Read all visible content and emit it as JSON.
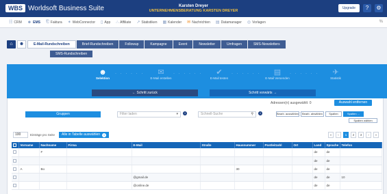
{
  "topbar": {
    "logo": "WBS",
    "app_name": "Worldsoft Business Suite",
    "user_name": "Karsten Dreyer",
    "company": "UNTERNEHMENSBERATUNG KARSTEN DREYER",
    "upgrade_label": "Upgrade",
    "help_glyph": "?",
    "settings_glyph": "⚙"
  },
  "nav": {
    "items": [
      {
        "icon": "grid-icon",
        "glyph": "☷",
        "label": "CRM"
      },
      {
        "icon": "people-icon",
        "glyph": "☻",
        "label": "EMS"
      },
      {
        "icon": "invoice-icon",
        "glyph": "⎗",
        "label": "Faktura"
      },
      {
        "icon": "connector-icon",
        "glyph": "✶",
        "label": "WebConnector"
      },
      {
        "icon": "app-icon",
        "glyph": "▯",
        "label": "App"
      },
      {
        "icon": "affiliate-icon",
        "glyph": "∴",
        "label": "Affiliate"
      },
      {
        "icon": "statistics-icon",
        "glyph": "↗",
        "label": "Statistiken"
      },
      {
        "icon": "calendar-icon",
        "glyph": "▦",
        "label": "Kalender"
      },
      {
        "icon": "messages-icon",
        "glyph": "✉",
        "label": "Nachrichten"
      },
      {
        "icon": "data-manager-icon",
        "glyph": "▤",
        "label": "Datamanager"
      },
      {
        "icon": "templates-icon",
        "glyph": "◎",
        "label": "Vorlagen"
      }
    ],
    "end_glyph": "%"
  },
  "module": {
    "home_glyph": "⌂",
    "people_glyph": "☻",
    "tabs": [
      {
        "label": "E-Mail-Rundschreiben",
        "active": true
      },
      {
        "label": "Brief-Rundschreiben",
        "active": false
      },
      {
        "label": "Followup",
        "active": false
      },
      {
        "label": "Kampagne",
        "active": false
      },
      {
        "label": "Event",
        "active": false
      },
      {
        "label": "Newsletter",
        "active": false
      },
      {
        "label": "Umfragen",
        "active": false
      },
      {
        "label": "SMS-Newsletters",
        "active": false
      }
    ],
    "subtab": "SMS-Rundschreiben"
  },
  "wizard": {
    "steps": [
      {
        "glyph": "☻",
        "label": "Selektion",
        "active": true
      },
      {
        "glyph": "✉",
        "label": "E-Mail erstellen",
        "active": false
      },
      {
        "glyph": "✔",
        "label": "E-Mail testen",
        "active": false
      },
      {
        "glyph": "▤",
        "label": "E-Mail Versenden",
        "active": false
      },
      {
        "glyph": "✈",
        "label": "Statistik",
        "active": false
      }
    ],
    "dots": "· · · · · ·",
    "back_label": "← Schritt zurück",
    "next_label": "Schritt vorwärts →"
  },
  "toolbar": {
    "selected_text": "Adressen(n) ausgewählt: 0",
    "remove_selection": "Auswahl entfernen",
    "groups_label": "Gruppen",
    "filter_placeholder": "Filter laden",
    "search_placeholder": "Schnell-Suche",
    "select_all_label": "Bearb. auswählen",
    "deselect_label": "Bearb. abwählen",
    "sort_label": "Spalten",
    "columns_label": "Spalten ...",
    "columns_setup": "Spalten wählen",
    "info_glyph": "i"
  },
  "list": {
    "per_page_value": "100",
    "per_page_label": "Einträge pro Seite",
    "select_all_table": "Alle in Tabelle auswählen",
    "pager": [
      "«",
      "‹",
      "1",
      "2",
      "3",
      "›",
      "»"
    ],
    "active_page": "1"
  },
  "table": {
    "columns": [
      "Vorname",
      "Nachname",
      "Firma",
      "E-Mail",
      "Straße",
      "Hausnummer",
      "Postleitzahl",
      "Ort",
      "Land",
      "Sprache",
      "Telefon"
    ],
    "rows": [
      [
        "",
        "F",
        "",
        "",
        "",
        "",
        "",
        "",
        "de",
        "de",
        ""
      ],
      [
        "",
        "",
        "",
        "",
        "",
        "",
        "",
        "",
        "de",
        "de",
        ""
      ],
      [
        "A",
        "Bo",
        "",
        "",
        "",
        "30",
        "",
        "",
        "de",
        "de",
        ""
      ],
      [
        "",
        "",
        "",
        "@gmail.de",
        "",
        "",
        "",
        "",
        "de",
        "de",
        "10"
      ],
      [
        "",
        "",
        "",
        "@online.de",
        "",
        "",
        "",
        "",
        "de",
        "de",
        ""
      ]
    ]
  }
}
